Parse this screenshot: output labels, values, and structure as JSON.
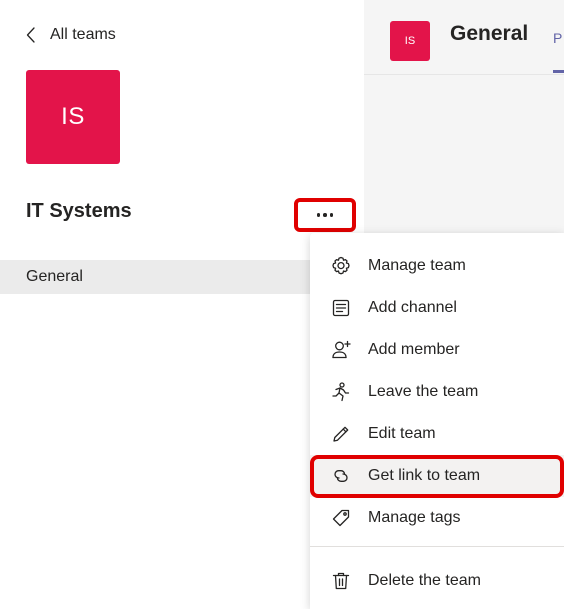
{
  "nav": {
    "back_label": "All teams"
  },
  "team": {
    "initials": "IS",
    "name": "IT Systems"
  },
  "channels": [
    {
      "label": "General"
    }
  ],
  "header": {
    "channel_initials": "IS",
    "channel_title": "General",
    "tab_label": "P"
  },
  "menu": {
    "items": [
      {
        "label": "Manage team",
        "icon": "gear-icon"
      },
      {
        "label": "Add channel",
        "icon": "channel-list-icon"
      },
      {
        "label": "Add member",
        "icon": "add-person-icon"
      },
      {
        "label": "Leave the team",
        "icon": "leave-runner-icon"
      },
      {
        "label": "Edit team",
        "icon": "pencil-icon"
      },
      {
        "label": "Get link to team",
        "icon": "link-icon",
        "highlighted": true
      },
      {
        "label": "Manage tags",
        "icon": "tag-icon"
      },
      {
        "label": "Delete the team",
        "icon": "trash-icon"
      }
    ]
  },
  "colors": {
    "team_accent": "#e3144a",
    "brand_purple": "#6264a7",
    "annotation_red": "#e00000"
  }
}
